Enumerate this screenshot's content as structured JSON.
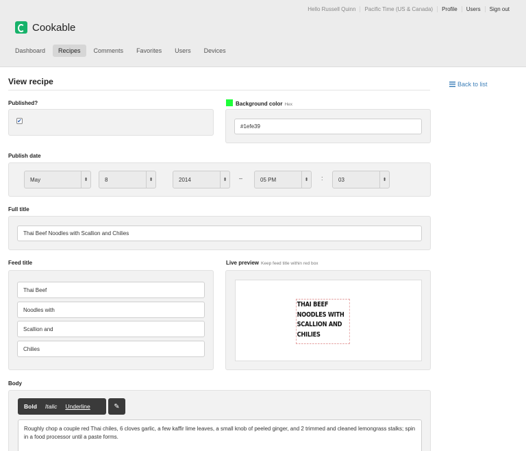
{
  "header": {
    "greeting": "Hello Russell Quinn",
    "timezone": "Pacific Time (US & Canada)",
    "links": [
      "Profile",
      "Users",
      "Sign out"
    ],
    "app_name": "Cookable"
  },
  "nav": {
    "tabs": [
      "Dashboard",
      "Recipes",
      "Comments",
      "Favorites",
      "Users",
      "Devices"
    ],
    "active": "Recipes"
  },
  "page": {
    "title": "View recipe",
    "back_label": "Back to list"
  },
  "form": {
    "published_label": "Published?",
    "published_checked": true,
    "checkmark": "✔",
    "bg_color_label": "Background color",
    "bg_color_hint": "Hex",
    "bg_color_value": "#1efe39",
    "publish_date_label": "Publish date",
    "month": "May",
    "day": "8",
    "year": "2014",
    "dash": "–",
    "hour": "05 PM",
    "colon": ":",
    "minute": "03",
    "spinner_glyph": "⬍",
    "full_title_label": "Full title",
    "full_title_value": "Thai Beef Noodles with Scallion and Chilies",
    "feed_title_label": "Feed title",
    "feed_title_lines": [
      "Thai Beef",
      "Noodles with",
      "Scallion and",
      "Chilies"
    ],
    "live_preview_label": "Live preview",
    "live_preview_hint": "Keep feed title within red box",
    "preview_lines": [
      "THAI BEEF",
      "NOODLES WITH",
      "SCALLION AND",
      "CHILIES"
    ],
    "body_label": "Body",
    "toolbar": {
      "bold": "Bold",
      "italic": "Italic",
      "underline": "Underline",
      "edit_glyph": "✎"
    },
    "body_text": "Roughly chop a couple red Thai chiles, 6 cloves garlic, a few kaffir lime leaves, a small knob of peeled ginger, and 2 trimmed and cleaned lemongrass stalks; spin in a food processor until a paste forms."
  },
  "colors": {
    "accent_green": "#1efe39",
    "link_blue": "#3d7fb8",
    "logo_green": "#17b26a"
  }
}
